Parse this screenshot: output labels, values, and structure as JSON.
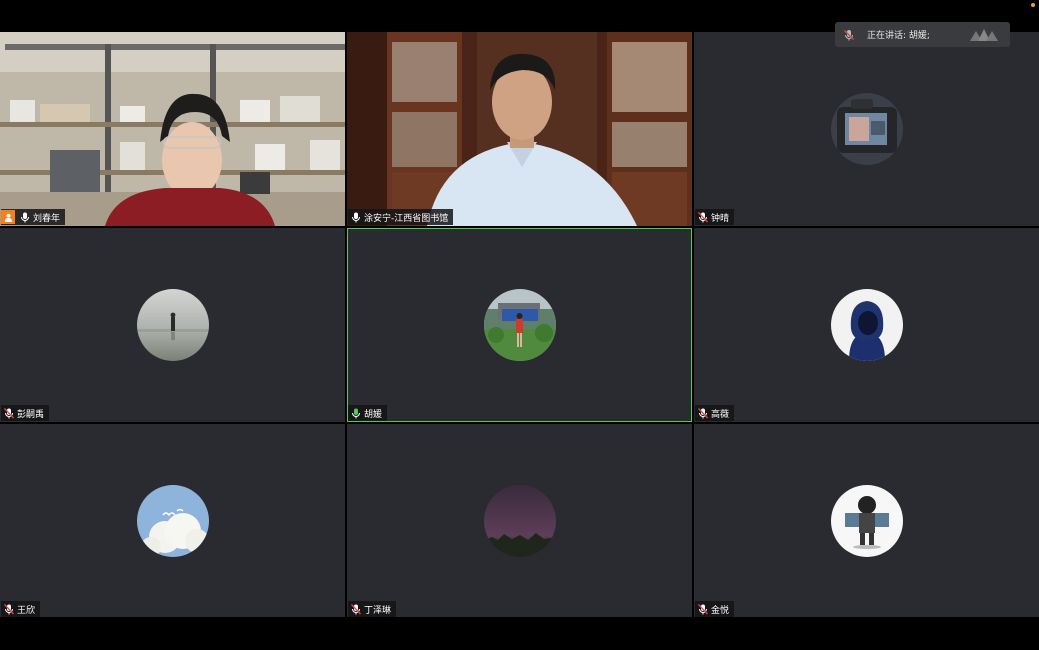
{
  "speaking_indicator": {
    "text": "正在讲话: 胡媛;"
  },
  "participants": [
    {
      "name": "刘春年",
      "mic": "on",
      "host": true,
      "video": "woman-shelves"
    },
    {
      "name": "涂安宁-江西省图书馆",
      "mic": "on",
      "host": false,
      "video": "man-bookcase"
    },
    {
      "name": "钟晴",
      "mic": "muted",
      "avatar": "camera"
    },
    {
      "name": "彭嗣禹",
      "mic": "muted",
      "avatar": "silhouette"
    },
    {
      "name": "胡媛",
      "mic": "on",
      "avatar": "garden",
      "active_speaker": true
    },
    {
      "name": "高薇",
      "mic": "muted",
      "avatar": "hoodie"
    },
    {
      "name": "王欣",
      "mic": "muted",
      "avatar": "cloud"
    },
    {
      "name": "丁泽琳",
      "mic": "muted",
      "avatar": "night-sky"
    },
    {
      "name": "金悦",
      "mic": "muted",
      "avatar": "cartoon-boy"
    }
  ],
  "colors": {
    "tile_bg": "#2a2b30",
    "active_border": "#4ad04a",
    "host_badge": "#f58020"
  }
}
